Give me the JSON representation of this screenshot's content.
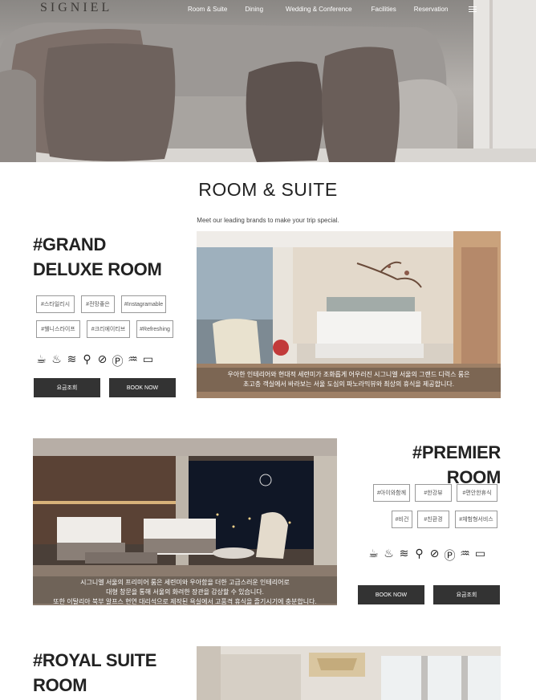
{
  "header": {
    "logo": "SIGNIEL",
    "menu": [
      "Room & Suite",
      "Dining",
      "Wedding & Conference",
      "Facilities",
      "Reservation"
    ]
  },
  "section": {
    "title": "ROOM & SUITE",
    "subtitle": "Meet our leading brands to make your trip special."
  },
  "rooms": [
    {
      "name_line1": "#GRAND",
      "name_line2": "DELUXE ROOM",
      "tags": [
        "#스타일리시",
        "#전망좋은",
        "#Instagramable",
        "#웰니스라이프",
        "#크리에이티브",
        "#Refreshing"
      ],
      "caption_line1": "우아한 인테리어와 현대적 세련미가 조화롭게 어우러진 시그니엘 서울의 그랜드 디럭스 룸은",
      "caption_line2": "초고층 객실에서 바라보는 서울 도심의 파노라믹뷰와 최상의 휴식을 제공합니다.",
      "btn1": "요금조회",
      "btn2": "BOOK NOW"
    },
    {
      "name": "#PREMIER ROOM",
      "tags": [
        "#아이와함께",
        "#한강뷰",
        "#편안한휴식",
        "#비건",
        "#친환경",
        "#체험형서비스"
      ],
      "caption_line1": "시그니엘 서울의 프리미어 룸은 세련미와 우아함을 더한 고급스러운 인테리어로",
      "caption_line2": "대형 창문을 통해 서울의 화려한 장관을 감상할 수 있습니다.",
      "caption_line3": "또한 이탈리아 북부 알프스 현연 대리석으로 제작된 욕실에서 고품격 휴식을 즐기시기에 충분합니다.",
      "btn1": "BOOK NOW",
      "btn2": "요금조회"
    },
    {
      "name_line1": "#ROYAL SUITE",
      "name_line2": "ROOM"
    }
  ],
  "amenity_icons": [
    "coffee-icon",
    "toiletries-icon",
    "wifi-icon",
    "hairdryer-icon",
    "no-smoking-icon",
    "parking-icon",
    "bath-icon",
    "bed-icon"
  ]
}
